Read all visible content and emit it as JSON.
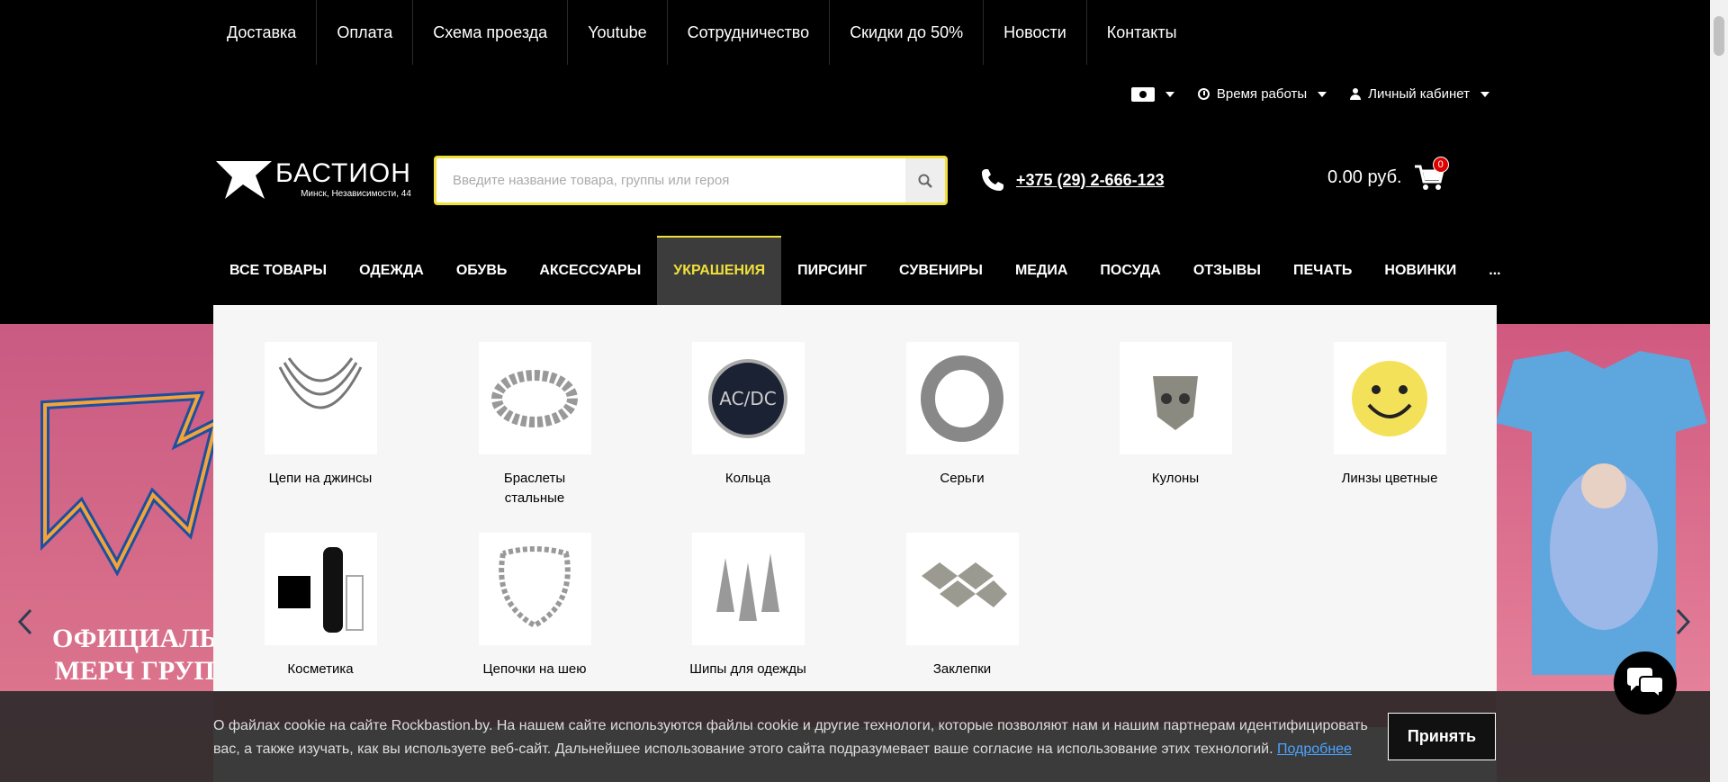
{
  "top_links": [
    "Доставка",
    "Оплата",
    "Схема проезда",
    "Youtube",
    "Сотрудничество",
    "Скидки до 50%",
    "Новости",
    "Контакты"
  ],
  "util": {
    "work_hours": "Время работы",
    "account": "Личный кабинет"
  },
  "logo": {
    "name": "БАСТИОН",
    "address": "Минск, Независимости, 44"
  },
  "search": {
    "placeholder": "Введите название товара, группы или героя"
  },
  "phone": "+375 (29) 2-666-123",
  "cart": {
    "total": "0.00 руб.",
    "count": "0"
  },
  "main_nav": [
    "ВСЕ ТОВАРЫ",
    "ОДЕЖДА",
    "ОБУВЬ",
    "АКСЕССУАРЫ",
    "УКРАШЕНИЯ",
    "ПИРСИНГ",
    "СУВЕНИРЫ",
    "МЕДИА",
    "ПОСУДА",
    "ОТЗЫВЫ",
    "ПЕЧАТЬ",
    "НОВИНКИ",
    "..."
  ],
  "dropdown": {
    "row1": [
      "Цепи на джинсы",
      "Браслеты стальные",
      "Кольца",
      "Серьги",
      "Кулоны",
      "Линзы цветные"
    ],
    "row2": [
      "Косметика",
      "Цепочки на шею",
      "Шипы для одежды",
      "Заклепки"
    ]
  },
  "banner": {
    "text_line1": "ОФИЦИАЛЬ",
    "text_line2": "МЕРЧ ГРУП"
  },
  "cookie": {
    "text": "О файлах cookie на сайте Rockbastion.by. На нашем сайте используются файлы cookie и другие технологи, которые позволяют нам и нашим партнерам идентифицировать вас, а также изучать, как вы используете веб-сайт. Дальнейшее использование этого сайта подразумевает ваше согласие на использование этих технологий.",
    "link": "Подробнее",
    "accept": "Принять"
  },
  "colors": {
    "accent": "#f0e03a",
    "badge": "#dd0000",
    "banner_bg": "#d8607c"
  }
}
